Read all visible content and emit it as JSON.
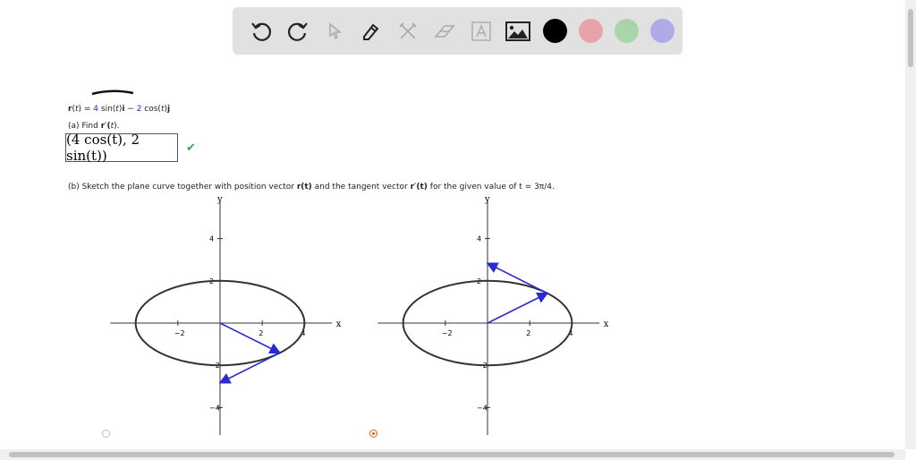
{
  "toolbar": {
    "tools": [
      "undo-icon",
      "redo-icon",
      "select-icon",
      "pen-icon",
      "tools-icon",
      "eraser-icon",
      "text-icon",
      "image-icon"
    ],
    "colors": [
      "#000000",
      "#e8a2aa",
      "#aad5aa",
      "#b0aae6"
    ]
  },
  "problem": {
    "vector_r": "r",
    "paren_open": "(",
    "t": "t",
    "paren_close": ")",
    "eq": " = ",
    "c1": "4",
    "sin": " sin(",
    "t2": "t",
    ")i": ")",
    "i": "i",
    " - ": " − ",
    "c2": "2",
    "cos": " cos(",
    "t3": "t",
    "close3": ")",
    "j": "j",
    "part_a": "(a) Find ",
    "part_a_r": "r′(",
    "part_a_t": "t",
    "part_a_end": ").",
    "answer": "(4 cos(t), 2 sin(t))",
    "check": "✔",
    "part_b": "(b) Sketch the plane curve together with position vector ",
    "part_b_r": "r(t)",
    "part_b_mid": " and the tangent vector ",
    "part_b_rp": "r′(t)",
    "part_b_end": " for the given value of ",
    "part_b_t": "t = 3π/4."
  },
  "chart_data": [
    {
      "type": "line",
      "title": "",
      "xlabel": "x",
      "ylabel": "y",
      "xticks": [
        "−2",
        "2",
        "4"
      ],
      "yticks": [
        "4",
        "2",
        "−2",
        "−4"
      ],
      "xtick_vals": [
        -2,
        2,
        4
      ],
      "ytick_vals": [
        4,
        2,
        -2,
        -4
      ],
      "xlim": [
        -5,
        5.5
      ],
      "ylim": [
        -5.2,
        5.8
      ],
      "ellipse": {
        "a": 4,
        "b": 2
      },
      "position_vector": [
        [
          0,
          0
        ],
        [
          2.83,
          -1.41
        ]
      ],
      "tangent_vector": [
        [
          2.83,
          -1.41
        ],
        [
          0,
          -2.83
        ]
      ],
      "selected": false
    },
    {
      "type": "line",
      "title": "",
      "xlabel": "x",
      "ylabel": "y",
      "xticks": [
        "−2",
        "2",
        "4"
      ],
      "yticks": [
        "4",
        "2",
        "−2",
        "−4"
      ],
      "xtick_vals": [
        -2,
        2,
        4
      ],
      "ytick_vals": [
        4,
        2,
        -2,
        -4
      ],
      "xlim": [
        -5,
        5.5
      ],
      "ylim": [
        -5.2,
        5.8
      ],
      "ellipse": {
        "a": 4,
        "b": 2
      },
      "position_vector": [
        [
          0,
          0
        ],
        [
          2.83,
          1.41
        ]
      ],
      "tangent_vector": [
        [
          2.83,
          1.41
        ],
        [
          0,
          2.83
        ]
      ],
      "selected": true
    }
  ]
}
